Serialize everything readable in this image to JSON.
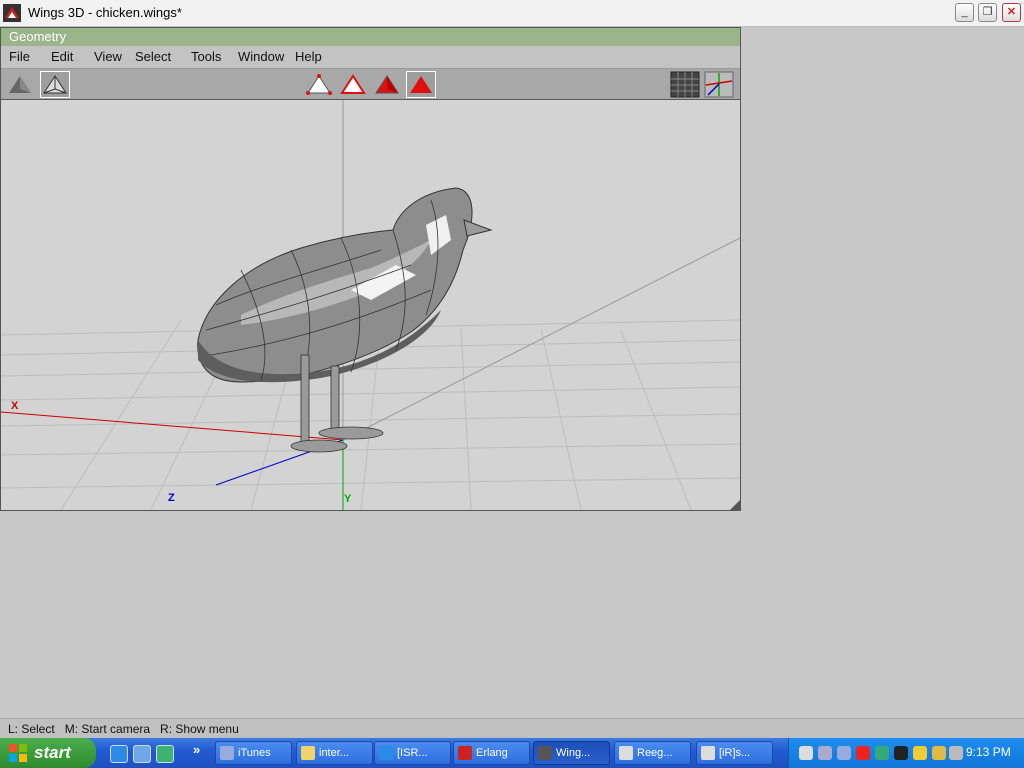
{
  "window": {
    "title": "Wings 3D - chicken.wings*",
    "controls": [
      "minimize",
      "restore",
      "close"
    ]
  },
  "geometry_window": {
    "title": "Geometry",
    "menu": [
      "File",
      "Edit",
      "View",
      "Select",
      "Tools",
      "Window",
      "Help"
    ],
    "toolbar": {
      "left": [
        "smooth-shaded-icon",
        "wireframe-icon"
      ],
      "center": [
        "vertex-mode-icon",
        "edge-mode-icon",
        "face-mode-icon",
        "body-mode-icon"
      ],
      "right": [
        "groundplane-icon",
        "axes-icon"
      ]
    },
    "axes": {
      "x": "X",
      "y": "Y",
      "z": "Z"
    }
  },
  "status": "L: Select   M: Start camera   R: Show menu",
  "taskbar": {
    "start_label": "start",
    "quick_more": "»",
    "tasks": [
      {
        "label": "iTunes",
        "active": false
      },
      {
        "label": "inter...",
        "active": false
      },
      {
        "label": "[ISR...",
        "active": false
      },
      {
        "label": "Erlang",
        "active": false
      },
      {
        "label": "Wing...",
        "active": true
      },
      {
        "label": "Reeg...",
        "active": false
      },
      {
        "label": "[iR]s...",
        "active": false
      }
    ],
    "clock": "9:13 PM"
  },
  "colors": {
    "geometry_titlebar": "#9ab58a",
    "taskbar": "#235bd2",
    "start_button": "#3a9b3a",
    "selection_red": "#e01010"
  }
}
